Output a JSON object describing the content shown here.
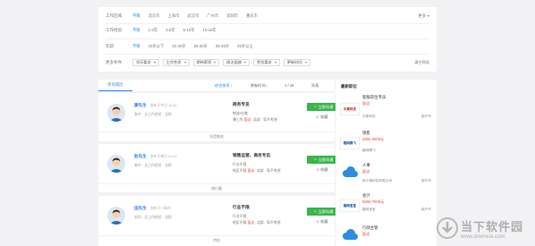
{
  "filters": {
    "area": {
      "label": "工作区域:",
      "options": [
        "不限",
        "北京市",
        "上海市",
        "武汉市",
        "广州市",
        "深圳市",
        "重庆市"
      ],
      "more": "更多"
    },
    "experience": {
      "label": "工作经验:",
      "options": [
        "不限",
        "1-3年",
        "3-5年",
        "5-10年",
        "10-15年"
      ]
    },
    "age": {
      "label": "年龄:",
      "options": [
        "不限",
        "20岁以下",
        "20-25岁",
        "25-35岁",
        "35-45岁",
        "45岁以上"
      ]
    },
    "more_conditions": {
      "label": "更多条件:",
      "dropdowns": [
        "学历要求",
        "工作性质",
        "期待薪资",
        "政治面貌",
        "性别要求",
        "更新时间"
      ],
      "clear": "清空筛选"
    }
  },
  "list_header": {
    "tab": "所有简历",
    "sort_default": "综合排序",
    "sort_update": "更新时间",
    "page": "1 / 15",
    "view": "列表"
  },
  "resumes": [
    {
      "name": "廖先生",
      "time": "发布于今日 12:42",
      "info": "高中 · 无工作经验 · 全职",
      "job": "商务专员",
      "line1": "物流/仓储",
      "line2_pre": "薄工作 ",
      "line2_red": "面议",
      "line2_post": "· 北部 · 驾不考虑",
      "chat": "立即沟通",
      "collect": "收藏",
      "tag": "抖音物流"
    },
    {
      "name": "赵先生",
      "time": "发布于前日 21:10",
      "info": "高中 · 无工作经验 · 全职",
      "job": "销售运营、商务专员",
      "line1": "行业不限",
      "line2_pre": "地区不限 ",
      "line2_red": "面议",
      "line2_post": "· 北部 · 驾不考虑",
      "chat": "立即沟通",
      "collect": "收藏",
      "tag": "旅行健"
    },
    {
      "name": "田先生",
      "time": "发布于一周内",
      "info": "本科 · 无工作经验 · 全职",
      "job": "行业不限",
      "line1": "行业不限",
      "line2_pre": "地区不限 ",
      "line2_red": "面议",
      "line2_post": "· 北部 · 驾不考虑",
      "chat": "立即沟通",
      "collect": "收藏",
      "tag": "供应"
    }
  ],
  "sidebar": {
    "title": "最新职位",
    "items": [
      {
        "logo": "华夏科技",
        "job": "客服岗位专员",
        "salary": "面议",
        "company": "华夏科技",
        "city": "南宁市"
      },
      {
        "logo": "趣网腾飞",
        "job": "销售",
        "salary": "2000-3000元",
        "company": "趣网腾飞",
        "city": ""
      },
      {
        "logo": "",
        "job": "人事",
        "salary": "面议",
        "company": "桥小微科技有限公司",
        "city": "南宁市"
      },
      {
        "logo": "趣网宝宝",
        "job": "会计",
        "salary": "5000-7000元",
        "company": "趣网宝宝",
        "city": "南宁市"
      },
      {
        "logo": "",
        "job": "行政主管",
        "salary": "面议",
        "company": "",
        "city": ""
      }
    ]
  },
  "watermark": {
    "cn": "当下软件园",
    "en": "www.downxia.com"
  },
  "colors": {
    "accent": "#2f80ed",
    "chat": "#39b54a",
    "salary": "#e9433e"
  }
}
